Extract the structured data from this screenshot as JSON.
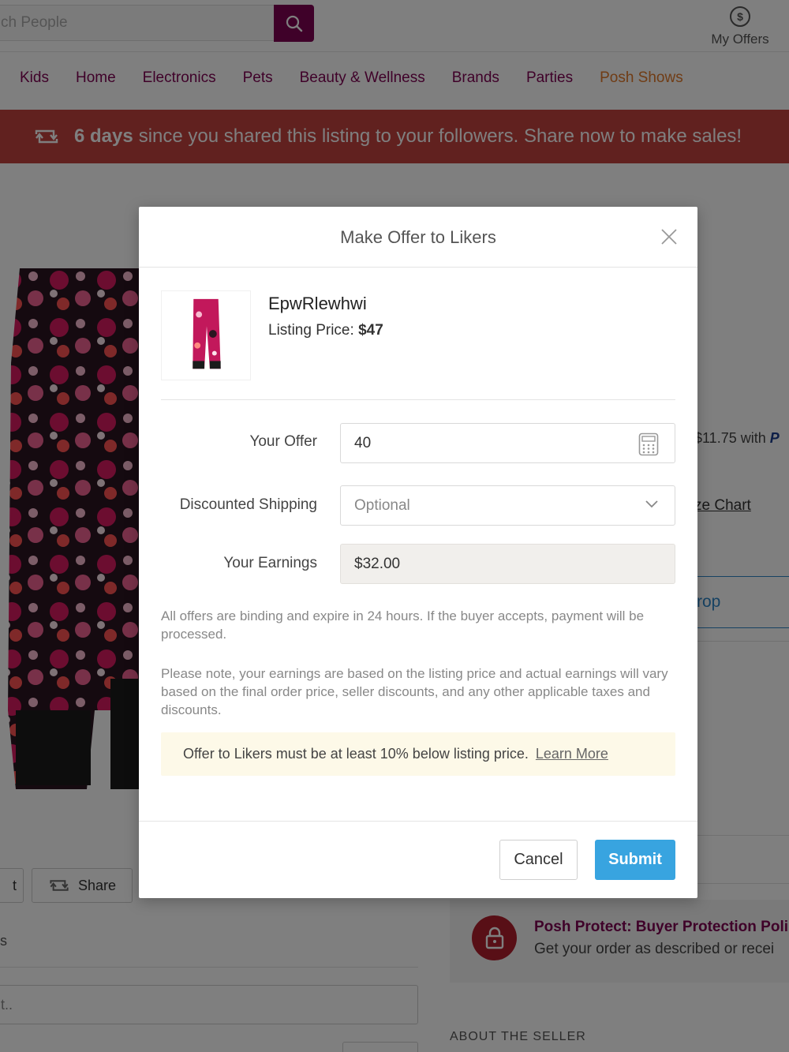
{
  "header": {
    "search_placeholder": "ch People",
    "my_offers_label": "My Offers"
  },
  "nav": {
    "items": [
      "Kids",
      "Home",
      "Electronics",
      "Pets",
      "Beauty & Wellness",
      "Brands",
      "Parties",
      "Posh Shows"
    ]
  },
  "share_banner": {
    "days": "6 days",
    "message": "since you shared this listing to your followers. Share now to make sales!"
  },
  "background": {
    "price_note": "$11.75 with ",
    "price_note_brand": "P",
    "size_chart": "ze Chart",
    "side_button": "rop",
    "share_button": "Share",
    "like_button": "t",
    "row_text": "s",
    "comment_placeholder": "t..",
    "posh_protect_title": "Posh Protect: Buyer Protection Poli",
    "posh_protect_sub": "Get your order as described or recei",
    "about_seller": "ABOUT THE SELLER"
  },
  "modal": {
    "title": "Make Offer to Likers",
    "product": {
      "name": "EpwRlewhwi",
      "price_label": "Listing Price:",
      "price_value": "$47"
    },
    "form": {
      "offer_label": "Your Offer",
      "offer_value": "40",
      "shipping_label": "Discounted Shipping",
      "shipping_value": "Optional",
      "earnings_label": "Your Earnings",
      "earnings_value": "$32.00"
    },
    "info_1": "All offers are binding and expire in 24 hours. If the buyer accepts, payment will be processed.",
    "info_2": "Please note, your earnings are based on the listing price and actual earnings will vary based on the final order price, seller discounts, and any other applicable taxes and discounts.",
    "notice": "Offer to Likers must be at least 10% below listing price.",
    "notice_link": "Learn More",
    "cancel_label": "Cancel",
    "submit_label": "Submit"
  },
  "colors": {
    "brand": "#7f0353",
    "banner": "#c2433f",
    "submit": "#38a4e0",
    "notice_bg": "#fdf9e8"
  },
  "icons": [
    "search-icon",
    "dollar-circle-icon",
    "share-loop-icon",
    "close-icon",
    "calculator-icon",
    "chevron-down-icon",
    "lock-icon"
  ]
}
